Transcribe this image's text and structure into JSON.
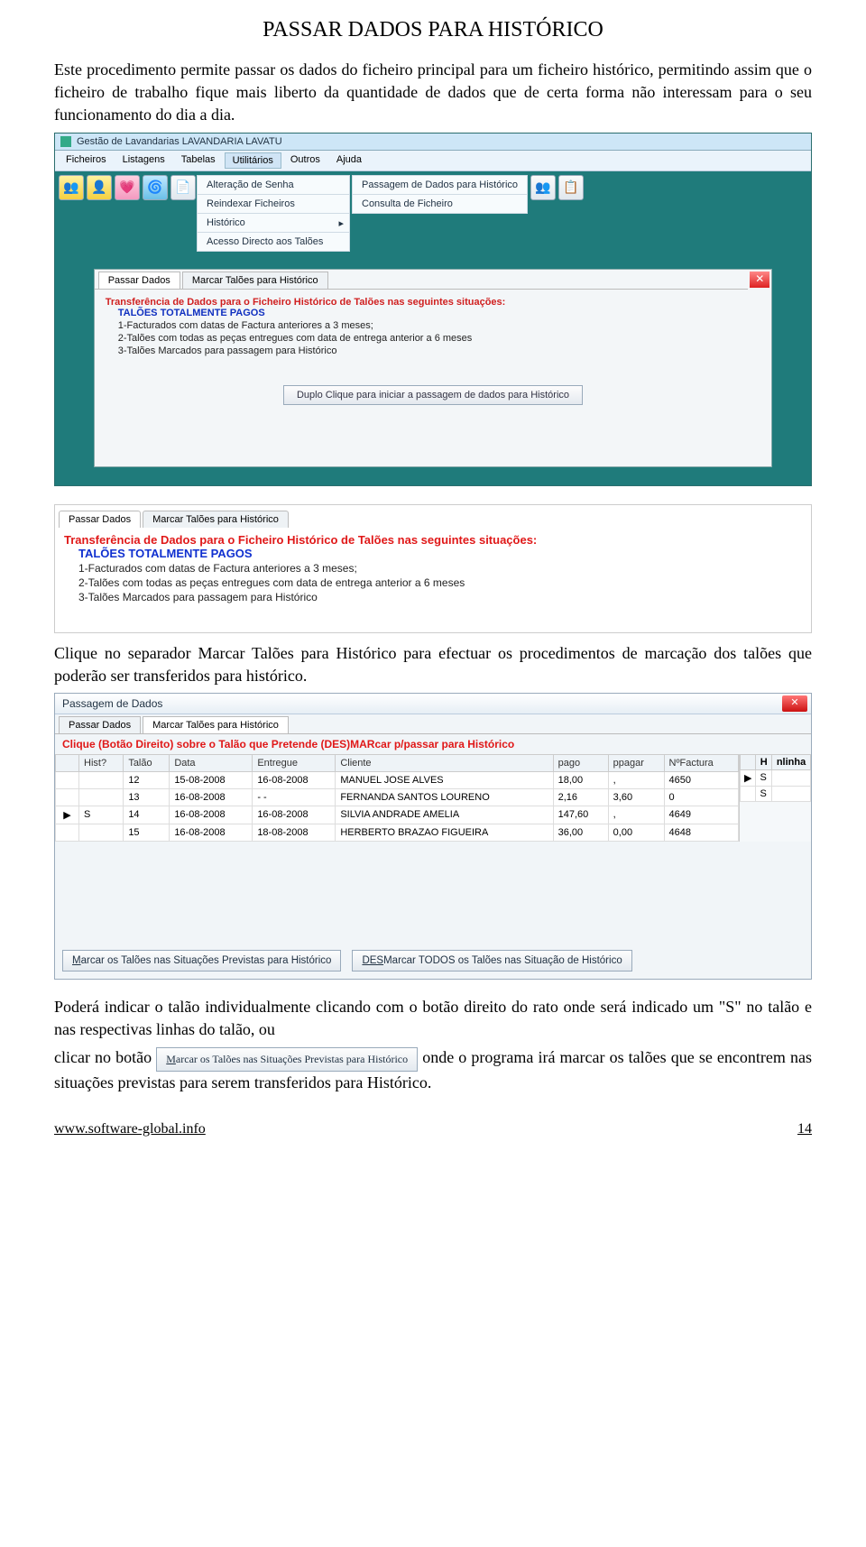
{
  "doc": {
    "title": "PASSAR DADOS PARA HISTÓRICO",
    "intro": "Este procedimento permite passar os dados do ficheiro principal para um ficheiro histórico, permitindo assim que o ficheiro de trabalho fique mais liberto da quantidade de dados que de certa forma não interessam para o seu funcionamento do dia a dia.",
    "para2": "Clique no separador Marcar Talões para Histórico para efectuar os procedimentos de marcação dos talões que poderão ser transferidos para histórico.",
    "para3a": "Poderá indicar o talão individualmente clicando com o botão direito do rato onde será indicado um \"S\" no talão e nas respectivas linhas do talão, ou",
    "para3b_prefix": "clicar no botão ",
    "para3b_button": "Marcar os Talões nas Situações Previstas para Histórico",
    "para3b_suffix": " onde o programa irá marcar os talões que se encontrem nas situações previstas para serem transferidos para Histórico."
  },
  "app1": {
    "title": "Gestão de Lavandarias   LAVANDARIA LAVATU",
    "menus": [
      "Ficheiros",
      "Listagens",
      "Tabelas",
      "Utilitários",
      "Outros",
      "Ajuda"
    ],
    "active_menu_index": 3,
    "dropdown": {
      "items": [
        "Alteração de Senha",
        "Reindexar Ficheiros",
        "Histórico",
        "Acesso Directo aos Talões"
      ],
      "submenu_parent_index": 2,
      "submenu": [
        "Passagem de Dados para Histórico",
        "Consulta de Ficheiro"
      ]
    },
    "modal": {
      "tabs": [
        "Passar Dados",
        "Marcar Talões para Histórico"
      ],
      "active_tab_index": 0,
      "red_line": "Transferência de Dados para o Ficheiro Histórico de Talões nas seguintes situações:",
      "blue_line": "TALÕES TOTALMENTE PAGOS",
      "lines": [
        "1-Facturados com datas de Factura anteriores a 3 meses;",
        "2-Talões com todas as peças entregues com data de entrega anterior a 6 meses",
        "3-Talões Marcados para passagem para  Histórico"
      ],
      "button": "Duplo Clique para iniciar a passagem de dados para Histórico"
    }
  },
  "section2": {
    "tabs": [
      "Passar Dados",
      "Marcar Talões para Histórico"
    ],
    "active_tab_index": 0,
    "red_line": "Transferência de Dados para o Ficheiro Histórico de Talões nas seguintes situações:",
    "blue_line": "TALÕES TOTALMENTE PAGOS",
    "lines": [
      "1-Facturados com datas de Factura anteriores a 3 meses;",
      "2-Talões com todas as peças entregues com data de entrega anterior a 6 meses",
      "3-Talões Marcados para passagem para  Histórico"
    ]
  },
  "window3": {
    "title": "Passagem de Dados",
    "tabs": [
      "Passar Dados",
      "Marcar Talões para Histórico"
    ],
    "active_tab_index": 1,
    "instruction": "Clique (Botão Direito) sobre o Talão que Pretende (DES)MARcar p/passar para Histórico",
    "columns": [
      "Hist?",
      "Talão",
      "Data",
      "Entregue",
      "Cliente",
      "pago",
      "ppagar",
      "NºFactura"
    ],
    "side_columns": [
      "H",
      "nlinha"
    ],
    "side_rows": [
      {
        "pointer": "▶",
        "h": "S",
        "n": ""
      },
      {
        "pointer": "",
        "h": "S",
        "n": ""
      }
    ],
    "rows": [
      {
        "mark": "",
        "hist": "",
        "talao": "12",
        "data": "15-08-2008",
        "entregue": "16-08-2008",
        "cliente": "MANUEL JOSE ALVES",
        "pago": "18,00",
        "ppagar": ",",
        "nfact": "4650"
      },
      {
        "mark": "",
        "hist": "",
        "talao": "13",
        "data": "16-08-2008",
        "entregue": "-  -",
        "cliente": "FERNANDA SANTOS LOURENO",
        "pago": "2,16",
        "ppagar": "3,60",
        "nfact": "0"
      },
      {
        "mark": "▶",
        "hist": "S",
        "talao": "14",
        "data": "16-08-2008",
        "entregue": "16-08-2008",
        "cliente": "SILVIA ANDRADE AMELIA",
        "pago": "147,60",
        "ppagar": ",",
        "nfact": "4649"
      },
      {
        "mark": "",
        "hist": "",
        "talao": "15",
        "data": "16-08-2008",
        "entregue": "18-08-2008",
        "cliente": "HERBERTO BRAZAO FIGUEIRA",
        "pago": "36,00",
        "ppagar": "0,00",
        "nfact": "4648"
      }
    ],
    "buttons": {
      "mark": "Marcar os Talões nas Situações Previstas para Histórico",
      "unmark_prefix": "DES",
      "unmark_rest": "Marcar TODOS os Talões nas Situação de  Histórico"
    }
  },
  "footer": {
    "url": "www.software-global.info",
    "page": "14"
  }
}
